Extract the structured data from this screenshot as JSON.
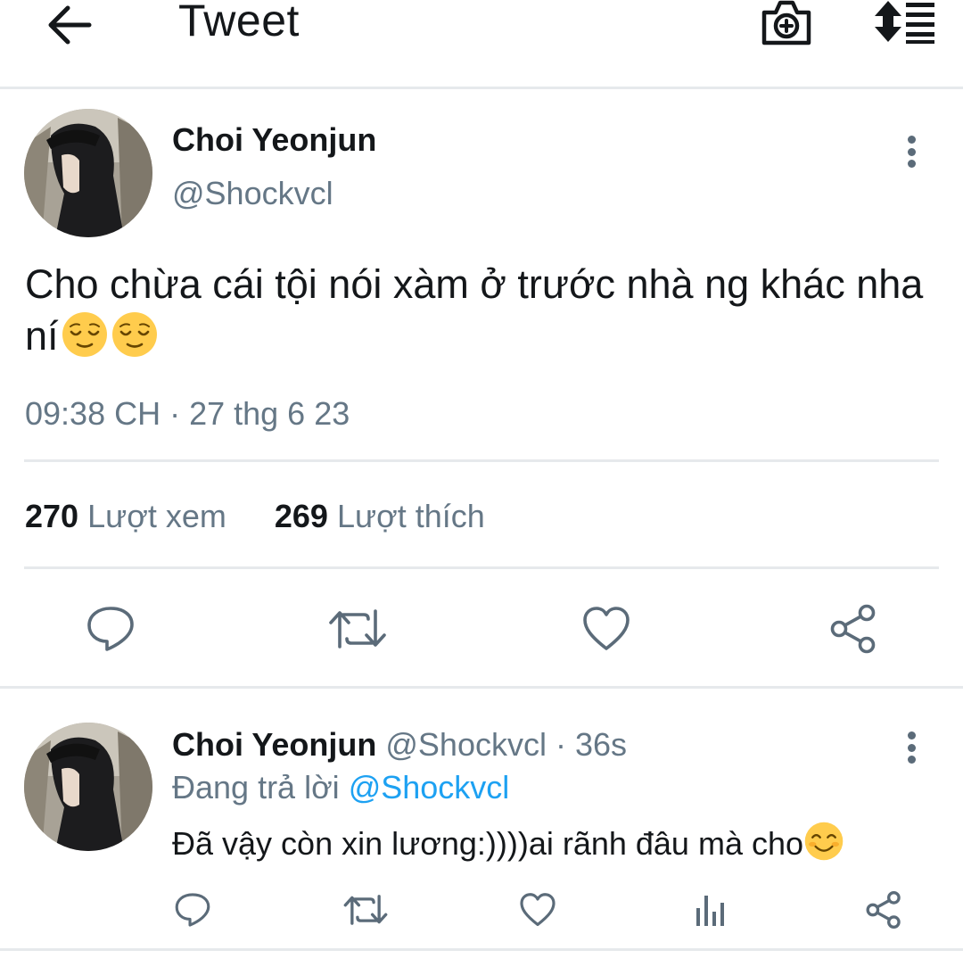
{
  "header": {
    "title": "Tweet",
    "back_icon": "arrow-left-icon",
    "camera_icon": "camera-plus-icon",
    "sort_icon": "sort-list-icon"
  },
  "tweet": {
    "author_name": "Choi Yeonjun",
    "author_handle": "@Shockvcl",
    "text": "Cho chừa cái tội nói xàm ở trước nhà ng khác nha ní",
    "emoji": [
      "relieved-face",
      "relieved-face"
    ],
    "timestamp": "09:38 CH · 27 thg 6 23",
    "views_count": "270",
    "views_label": "Lượt xem",
    "likes_count": "269",
    "likes_label": "Lượt thích",
    "actions": [
      "reply-icon",
      "retweet-icon",
      "like-icon",
      "share-icon"
    ]
  },
  "reply": {
    "author_name": "Choi Yeonjun",
    "meta": "@Shockvcl · 36s",
    "replying_prefix": "Đang trả lời",
    "replying_to": "@Shockvcl",
    "text": "Đã vậy còn xin lương:))))ai rãnh đâu mà cho",
    "emoji": "smiling-face",
    "actions": [
      "reply-icon",
      "retweet-icon",
      "like-icon",
      "analytics-icon",
      "share-icon"
    ]
  },
  "colors": {
    "text_primary": "#14171a",
    "text_secondary": "#657786",
    "link": "#1da1f2",
    "divider": "#e6e9ec"
  }
}
